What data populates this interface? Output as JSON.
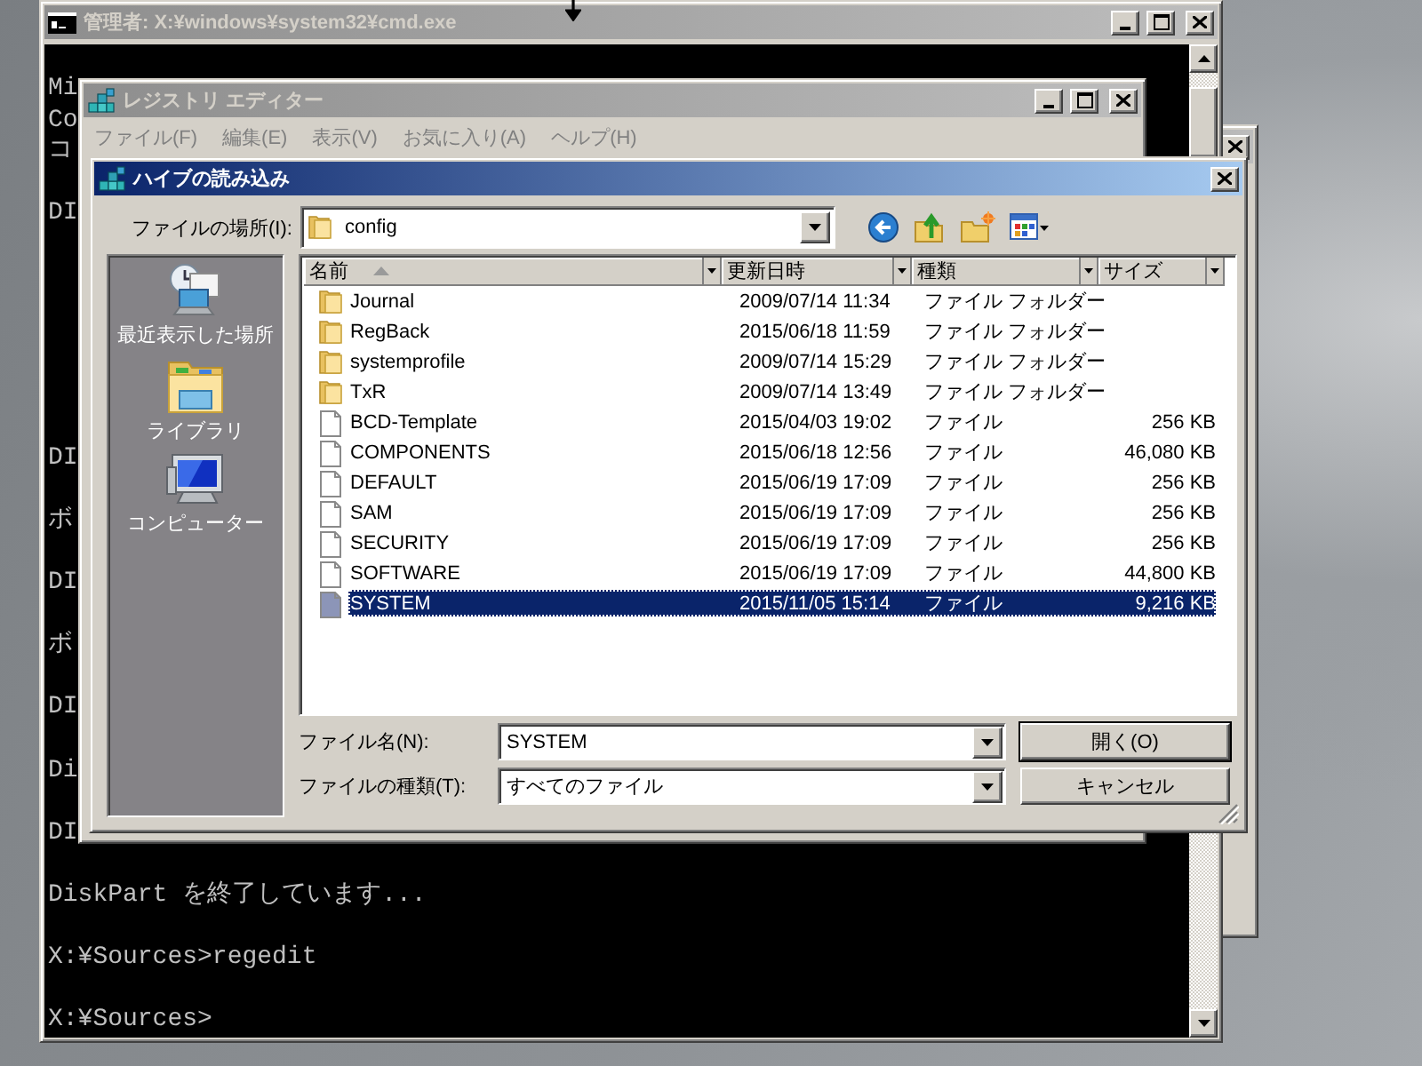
{
  "console_window": {
    "title": "管理者: X:¥windows¥system32¥cmd.exe",
    "upper_blocks": [
      [
        "Mi",
        "Co",
        "コ"
      ],
      [
        "DI"
      ]
    ],
    "lower_blocks": [
      [
        "DI"
      ],
      [
        "ボ"
      ],
      [
        "DI"
      ],
      [
        "ボ"
      ],
      [
        "DI"
      ],
      [
        "Di"
      ],
      [
        "DI"
      ],
      [
        "DiskPart を終了しています..."
      ],
      [
        "X:¥Sources>regedit"
      ],
      [
        "X:¥Sources>"
      ]
    ]
  },
  "registry_window": {
    "title": "レジストリ エディター",
    "menu": [
      "ファイル(F)",
      "編集(E)",
      "表示(V)",
      "お気に入り(A)",
      "ヘルプ(H)"
    ]
  },
  "dialog": {
    "title": "ハイブの読み込み",
    "location_label": "ファイルの場所(I):",
    "location": "config",
    "places": [
      {
        "kind": "recent",
        "label": "最近表示した場所"
      },
      {
        "kind": "library",
        "label": "ライブラリ"
      },
      {
        "kind": "computer",
        "label": "コンピューター"
      }
    ],
    "columns": [
      {
        "label": "名前",
        "sorted": true
      },
      {
        "label": "更新日時",
        "sorted": false
      },
      {
        "label": "種類",
        "sorted": false
      },
      {
        "label": "サイズ",
        "sorted": false
      }
    ],
    "rows": [
      {
        "kind": "folder",
        "name": "Journal",
        "modified": "2009/07/14 11:34",
        "type": "ファイル フォルダー",
        "selected": false
      },
      {
        "kind": "folder",
        "name": "RegBack",
        "modified": "2015/06/18 11:59",
        "type": "ファイル フォルダー",
        "selected": false
      },
      {
        "kind": "folder",
        "name": "systemprofile",
        "modified": "2009/07/14 15:29",
        "type": "ファイル フォルダー",
        "selected": false
      },
      {
        "kind": "folder",
        "name": "TxR",
        "modified": "2009/07/14 13:49",
        "type": "ファイル フォルダー",
        "selected": false
      },
      {
        "kind": "file",
        "name": "BCD-Template",
        "modified": "2015/04/03 19:02",
        "type": "ファイル",
        "size": "256 KB",
        "selected": false
      },
      {
        "kind": "file",
        "name": "COMPONENTS",
        "modified": "2015/06/18 12:56",
        "type": "ファイル",
        "size": "46,080 KB",
        "selected": false
      },
      {
        "kind": "file",
        "name": "DEFAULT",
        "modified": "2015/06/19 17:09",
        "type": "ファイル",
        "size": "256 KB",
        "selected": false
      },
      {
        "kind": "file",
        "name": "SAM",
        "modified": "2015/06/19 17:09",
        "type": "ファイル",
        "size": "256 KB",
        "selected": false
      },
      {
        "kind": "file",
        "name": "SECURITY",
        "modified": "2015/06/19 17:09",
        "type": "ファイル",
        "size": "256 KB",
        "selected": false
      },
      {
        "kind": "file",
        "name": "SOFTWARE",
        "modified": "2015/06/19 17:09",
        "type": "ファイル",
        "size": "44,800 KB",
        "selected": false
      },
      {
        "kind": "file",
        "name": "SYSTEM",
        "modified": "2015/11/05 15:14",
        "type": "ファイル",
        "size": "9,216 KB",
        "selected": true
      }
    ],
    "file_name_label": "ファイル名(N):",
    "file_name": "SYSTEM",
    "file_type_label": "ファイルの種類(T):",
    "file_type": "すべてのファイル",
    "buttons": [
      {
        "kind": "default",
        "label": "開く(O)"
      },
      {
        "kind": "normal",
        "label": "キャンセル"
      }
    ]
  }
}
